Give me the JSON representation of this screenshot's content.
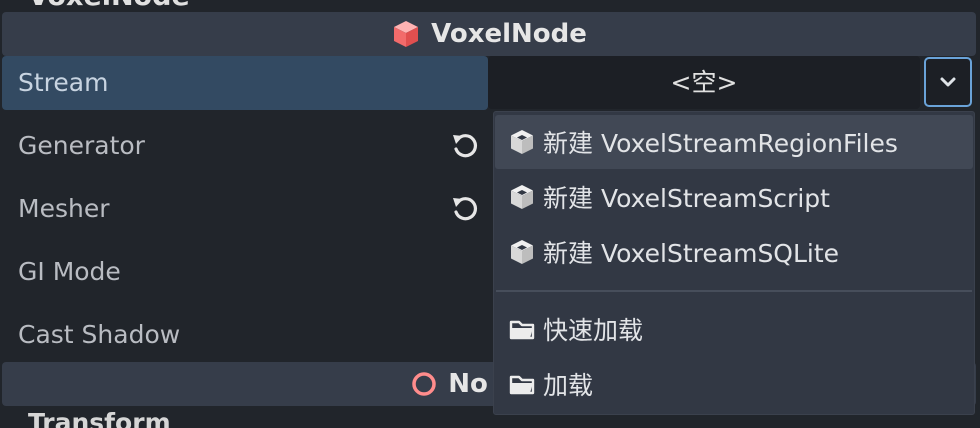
{
  "top_section": {
    "label": "VoxelNode"
  },
  "properties": [
    {
      "name": "Stream"
    },
    {
      "name": "Generator"
    },
    {
      "name": "Mesher"
    },
    {
      "name": "GI Mode"
    },
    {
      "name": "Cast Shadow"
    }
  ],
  "stream_value": "<空>",
  "popup_menu": {
    "items": [
      {
        "label": "新建 VoxelStreamRegionFiles",
        "icon": "resource-cube-icon"
      },
      {
        "label": "新建 VoxelStreamScript",
        "icon": "resource-cube-icon"
      },
      {
        "label": "新建 VoxelStreamSQLite",
        "icon": "resource-cube-icon"
      },
      {
        "label": "快速加载",
        "icon": "folder-icon"
      },
      {
        "label": "加载",
        "icon": "folder-icon"
      }
    ]
  },
  "second_section": {
    "label_partial": "No"
  },
  "cut_top_label": "VoxelNode",
  "cut_bottom_label": "Transform",
  "colors": {
    "background": "#21252b",
    "section_header": "#363d4a",
    "selected_row": "#334a62",
    "accent": "#6aa3d9",
    "voxel_icon": "#f26b6b",
    "node_icon": "#ff8c8c"
  }
}
